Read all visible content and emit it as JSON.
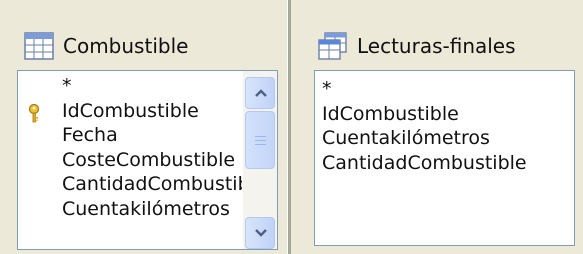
{
  "left_panel": {
    "title": "Combustible",
    "icon": "table-icon",
    "fields": [
      {
        "label": "*",
        "key": false
      },
      {
        "label": "IdCombustible",
        "key": true
      },
      {
        "label": "Fecha",
        "key": false
      },
      {
        "label": "CosteCombustible",
        "key": false
      },
      {
        "label": "CantidadCombustible",
        "key": false
      },
      {
        "label": "Cuentakilómetros",
        "key": false
      }
    ]
  },
  "right_panel": {
    "title": "Lecturas-finales",
    "icon": "query-icon",
    "fields": [
      {
        "label": "*"
      },
      {
        "label": "IdCombustible"
      },
      {
        "label": "Cuentakilómetros"
      },
      {
        "label": "CantidadCombustible"
      }
    ]
  },
  "colors": {
    "background": "#ece9d8",
    "list_border": "#7f9db9",
    "scrollbar_button": "#c1d3fb",
    "key_icon": "#e0b020"
  }
}
